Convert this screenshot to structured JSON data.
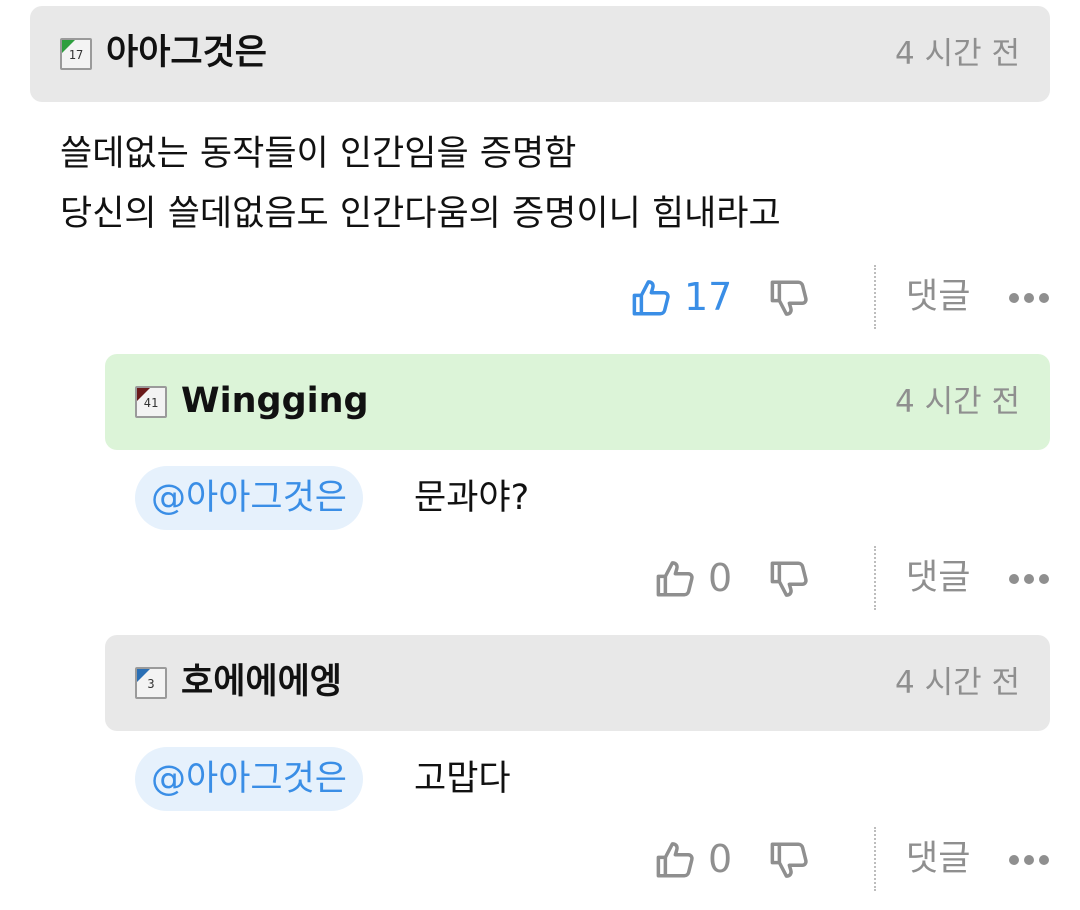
{
  "comment": {
    "level": "17",
    "username": "아아그것은",
    "time": "4 시간 전",
    "lines": [
      "쓸데없는 동작들이 인간임을 증명함",
      "당신의 쓸데없음도 인간다움의 증명이니 힘내라고"
    ],
    "likes": "17",
    "reply_label": "댓글"
  },
  "replies": [
    {
      "level": "41",
      "username": "Wingging",
      "time": "4 시간 전",
      "mention": "@아아그것은",
      "text": "문과야?",
      "likes": "0",
      "reply_label": "댓글"
    },
    {
      "level": "3",
      "username": "호에에에엥",
      "time": "4 시간 전",
      "mention": "@아아그것은",
      "text": "고맙다",
      "likes": "0",
      "reply_label": "댓글"
    }
  ],
  "colors": {
    "like_active": "#3a8ee6",
    "like_inactive": "#8f8f8f",
    "header_default": "#e8e8e8",
    "header_highlight": "#dcf4d8",
    "level_17": "#2e9e3e",
    "level_41": "#6b1a1a",
    "level_3": "#2a6fb5"
  }
}
